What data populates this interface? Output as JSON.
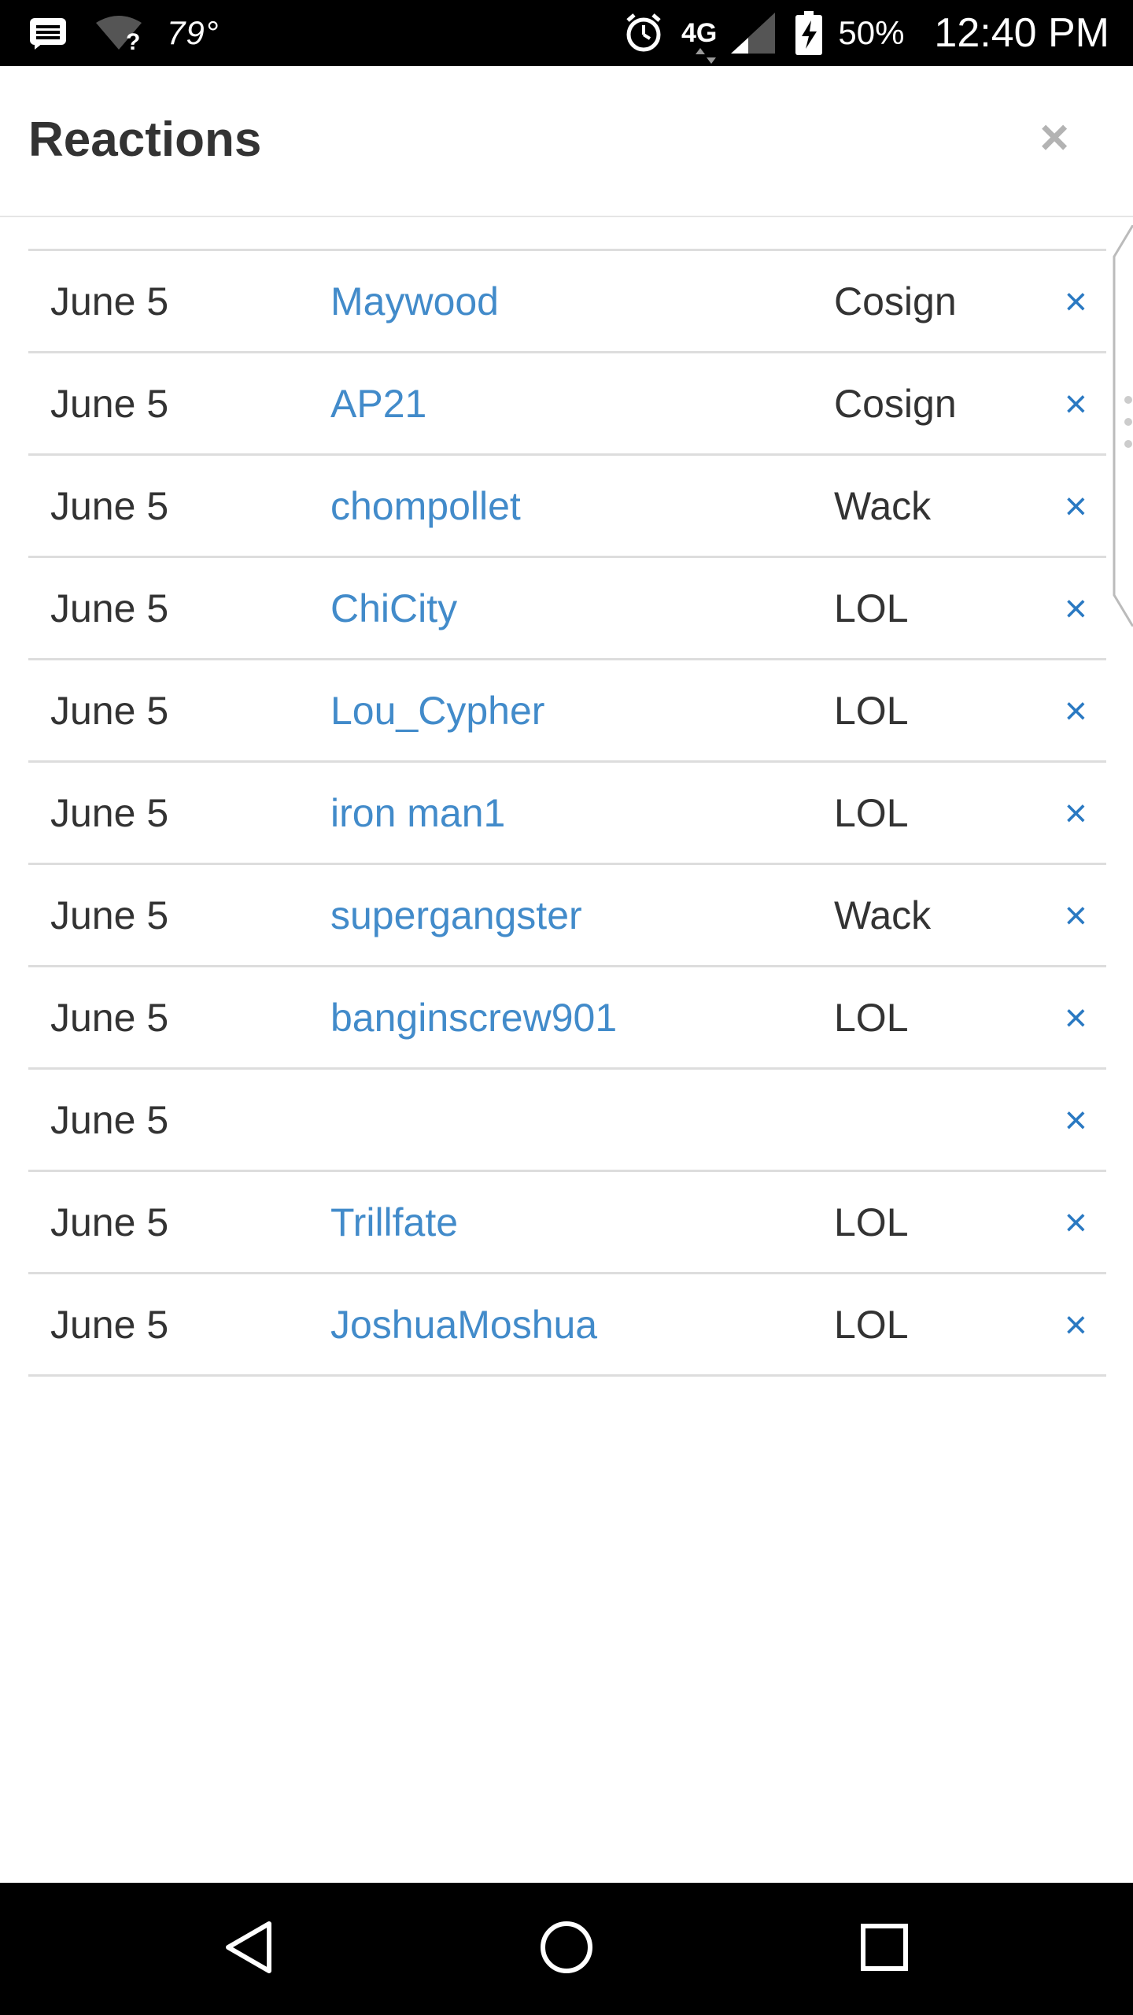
{
  "status_bar": {
    "temperature": "79°",
    "network": "4G",
    "battery": "50%",
    "time": "12:40 PM",
    "icons": [
      "message-icon",
      "wifi-unknown-icon",
      "alarm-icon",
      "lte-data-icon",
      "cell-signal-icon",
      "battery-charging-icon"
    ]
  },
  "modal": {
    "title": "Reactions",
    "close_label": "×"
  },
  "reactions": [
    {
      "date": "June 5",
      "user": "Maywood",
      "reaction": "Cosign",
      "remove": "×"
    },
    {
      "date": "June 5",
      "user": "AP21",
      "reaction": "Cosign",
      "remove": "×"
    },
    {
      "date": "June 5",
      "user": "chompollet",
      "reaction": "Wack",
      "remove": "×"
    },
    {
      "date": "June 5",
      "user": "ChiCity",
      "reaction": "LOL",
      "remove": "×"
    },
    {
      "date": "June 5",
      "user": "Lou_Cypher",
      "reaction": "LOL",
      "remove": "×"
    },
    {
      "date": "June 5",
      "user": "iron man1",
      "reaction": "LOL",
      "remove": "×"
    },
    {
      "date": "June 5",
      "user": "supergangster",
      "reaction": "Wack",
      "remove": "×"
    },
    {
      "date": "June 5",
      "user": "banginscrew901",
      "reaction": "LOL",
      "remove": "×"
    },
    {
      "date": "June 5",
      "user": "",
      "reaction": "",
      "remove": "×"
    },
    {
      "date": "June 5",
      "user": "Trillfate",
      "reaction": "LOL",
      "remove": "×"
    },
    {
      "date": "June 5",
      "user": "JoshuaMoshua",
      "reaction": "LOL",
      "remove": "×"
    }
  ],
  "nav_bar": {
    "icons": [
      "back-icon",
      "home-icon",
      "recents-icon"
    ]
  },
  "colors": {
    "link": "#428bca",
    "remove": "#2a79c2",
    "text": "#333333",
    "divider": "#dddddd",
    "close": "#b3b3b3"
  }
}
